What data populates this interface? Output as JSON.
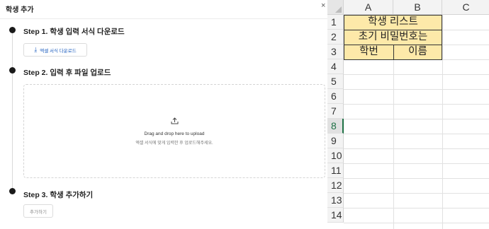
{
  "dialog": {
    "title": "학생 추가",
    "close_label": "×",
    "steps": [
      {
        "title": "Step 1. 학생 입력 서식 다운로드",
        "button_label": "엑셀 서식 다운로드",
        "button_icon": "download-icon"
      },
      {
        "title": "Step 2. 입력 후 파일 업로드",
        "dropzone_icon": "upload-icon",
        "dropzone_text": "Drag and drop here to upload",
        "dropzone_subtext": "엑셀 서식에 맞게 입력한 후 업로드해주세요."
      },
      {
        "title": "Step 3. 학생 추가하기",
        "button_label": "추가하기"
      }
    ]
  },
  "sheet": {
    "columns": [
      "A",
      "B",
      "C"
    ],
    "rows": [
      "1",
      "2",
      "3",
      "4",
      "5",
      "6",
      "7",
      "8",
      "9",
      "10",
      "11",
      "12",
      "13",
      "14"
    ],
    "active_row": "8",
    "cells": {
      "A1": "학생 리스트",
      "A2": "초기 비밀번호는",
      "A3": "학번",
      "B3": "이름"
    },
    "fill_color": "#fde9a9"
  }
}
